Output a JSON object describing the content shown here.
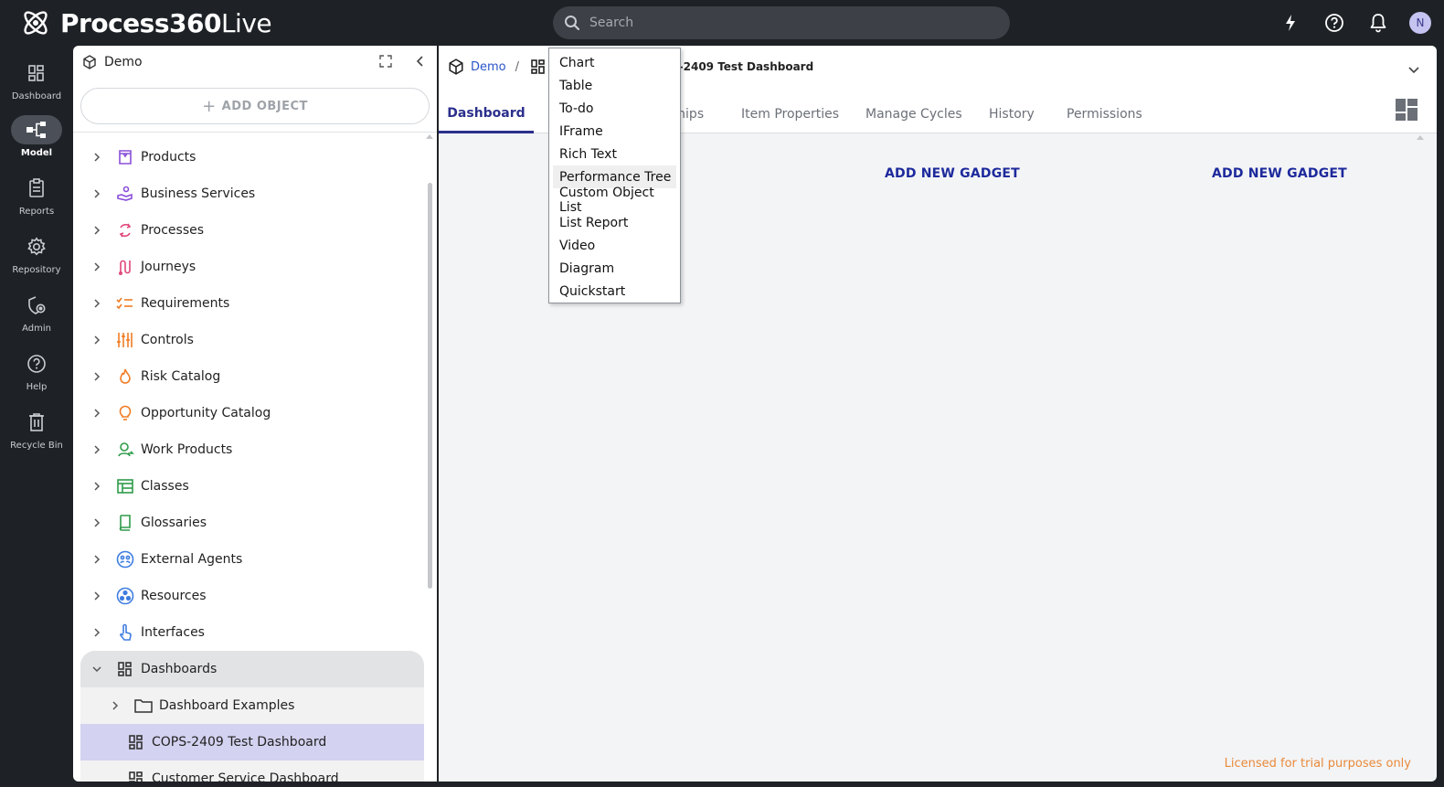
{
  "app": {
    "brand_bold": "Process360",
    "brand_light": "Live"
  },
  "search": {
    "placeholder": "Search"
  },
  "user": {
    "initial": "N"
  },
  "rail": [
    {
      "label": "Dashboard",
      "icon": "dashboard-icon"
    },
    {
      "label": "Model",
      "icon": "model-icon"
    },
    {
      "label": "Reports",
      "icon": "reports-icon"
    },
    {
      "label": "Repository",
      "icon": "gear-icon"
    },
    {
      "label": "Admin",
      "icon": "admin-icon"
    },
    {
      "label": "Help",
      "icon": "help-icon"
    },
    {
      "label": "Recycle Bin",
      "icon": "trash-icon"
    }
  ],
  "panel": {
    "title": "Demo",
    "add_object": "ADD OBJECT"
  },
  "tree": [
    {
      "label": "Products",
      "color": "#8a4fd8"
    },
    {
      "label": "Business Services",
      "color": "#8a4fd8"
    },
    {
      "label": "Processes",
      "color": "#e0457b"
    },
    {
      "label": "Journeys",
      "color": "#e0457b"
    },
    {
      "label": "Requirements",
      "color": "#f07c24"
    },
    {
      "label": "Controls",
      "color": "#f07c24"
    },
    {
      "label": "Risk Catalog",
      "color": "#f07c24"
    },
    {
      "label": "Opportunity Catalog",
      "color": "#f07c24"
    },
    {
      "label": "Work Products",
      "color": "#2e9b4a"
    },
    {
      "label": "Classes",
      "color": "#2e9b4a"
    },
    {
      "label": "Glossaries",
      "color": "#2e9b4a"
    },
    {
      "label": "External Agents",
      "color": "#3f7ee0"
    },
    {
      "label": "Resources",
      "color": "#3f7ee0"
    },
    {
      "label": "Interfaces",
      "color": "#3f7ee0"
    },
    {
      "label": "Dashboards",
      "color": "#333333"
    },
    {
      "label": "Dashboard Examples",
      "color": "#333333"
    },
    {
      "label": "COPS-2409 Test Dashboard",
      "color": "#333333"
    },
    {
      "label": "Customer Service Dashboard",
      "color": "#333333"
    }
  ],
  "breadcrumb": {
    "root": "Demo",
    "separator": "/",
    "title_visible": "S-2409 Test Dashboard"
  },
  "tabs": [
    {
      "label": "Dashboard",
      "active": true
    },
    {
      "label": "nships",
      "active": false
    },
    {
      "label": "Item Properties",
      "active": false
    },
    {
      "label": "Manage Cycles",
      "active": false
    },
    {
      "label": "History",
      "active": false
    },
    {
      "label": "Permissions",
      "active": false
    }
  ],
  "gadgets": [
    "ADD NEW GADGET",
    "ADD NEW GADGET"
  ],
  "licensed": "Licensed for trial purposes only",
  "menu": {
    "items": [
      "Chart",
      "Table",
      "To-do",
      "IFrame",
      "Rich Text",
      "Performance Tree",
      "Custom Object List",
      "List Report",
      "Video",
      "Diagram",
      "Quickstart"
    ],
    "hovered": "Performance Tree"
  },
  "colors": {
    "accent": "#2b2f8c",
    "topbar": "#1e2226",
    "licensed": "#e98a3b"
  }
}
